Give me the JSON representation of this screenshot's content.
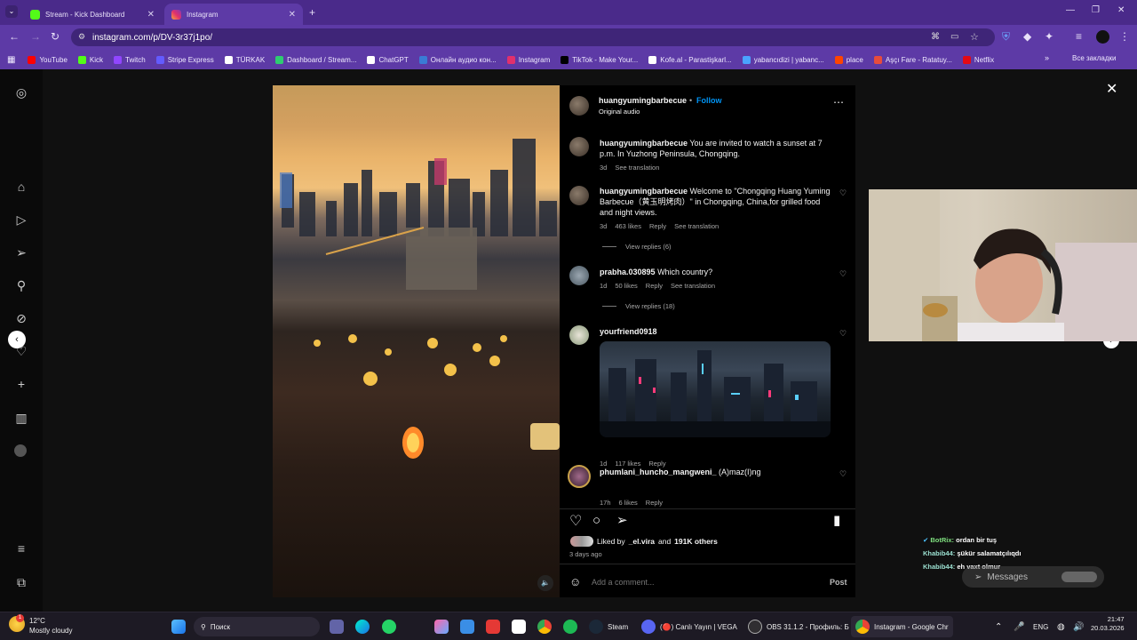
{
  "tabs": [
    {
      "title": "Stream - Kick Dashboard",
      "active": false
    },
    {
      "title": "Instagram",
      "active": true
    }
  ],
  "url": "instagram.com/p/DV-3r37j1po/",
  "bookmarks": [
    "YouTube",
    "Kick",
    "Twitch",
    "Stripe Express",
    "TÜRKAK",
    "Dashboard / Stream...",
    "ChatGPT",
    "Онлайн аудио кон...",
    "Instagram",
    "TikTok - Make Your...",
    "Kofe.al - Parastişkarl...",
    "yabancıdizi | yabanc...",
    "place",
    "Aşçı Fare - Ratatuy...",
    "Netflix"
  ],
  "bookmarks_all": "Все закладки",
  "post": {
    "author": "huangyumingbarbecue",
    "follow": "Follow",
    "audio": "Original audio",
    "liked_by_prefix": "Liked by",
    "liked_by_user": "_el.vira",
    "liked_by_and": "and",
    "liked_by_count": "191K others",
    "posted": "3 days ago",
    "add_comment_placeholder": "Add a comment...",
    "post_button": "Post"
  },
  "comments": [
    {
      "user": "huangyumingbarbecue",
      "text": "You are invited to watch a sunset at 7 p.m. In Yuzhong Peninsula, Chongqing.",
      "time": "3d",
      "likes": "",
      "reply": "",
      "translation": "See translation",
      "replies": ""
    },
    {
      "user": "huangyumingbarbecue",
      "text": "Welcome to \"Chongqing Huang Yuming Barbecue（黄玉明烤肉）\" in Chongqing, China,for grilled food and night views.",
      "time": "3d",
      "likes": "463 likes",
      "reply": "Reply",
      "translation": "See translation",
      "replies": "View replies (6)"
    },
    {
      "user": "prabha.030895",
      "text": "Which country?",
      "time": "1d",
      "likes": "50 likes",
      "reply": "Reply",
      "translation": "See translation",
      "replies": "View replies (18)"
    },
    {
      "user": "yourfriend0918",
      "text": "",
      "time": "1d",
      "likes": "117 likes",
      "reply": "Reply",
      "translation": "",
      "replies": ""
    },
    {
      "user": "phumlani_huncho_mangweni_",
      "text": "(A)maz(I)ng",
      "time": "17h",
      "likes": "6 likes",
      "reply": "Reply",
      "translation": "",
      "replies": ""
    }
  ],
  "chat": [
    {
      "user": "BotRix:",
      "text": "ordan bir tuş"
    },
    {
      "user": "Khabib44:",
      "text": "şükür salamatçılıqdı"
    },
    {
      "user": "Khabib44:",
      "text": "eh vaxt olmur"
    }
  ],
  "messages_label": "Messages",
  "taskbar": {
    "weather_temp": "12°C",
    "weather_desc": "Mostly cloudy",
    "search": "Поиск",
    "apps": [
      "Steam",
      "(🔴) Canlı Yayın | VEGA",
      "OBS 31.1.2 - Профиль: Б",
      "Instagram - Google Chr"
    ],
    "lang": "ENG",
    "time": "21:47",
    "date": "20.03.2026",
    "notif_badge": "1"
  },
  "colors": {
    "follow": "#0095f6",
    "tabbar": "#4a2a8a",
    "chrome": "#5d3aa6"
  }
}
